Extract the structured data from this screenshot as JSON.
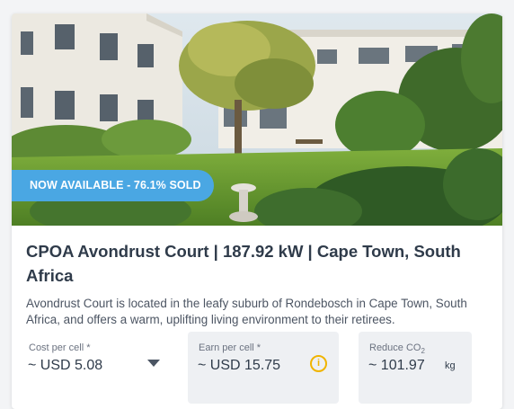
{
  "listing": {
    "badge": "NOW AVAILABLE - 76.1% SOLD",
    "title": "CPOA Avondrust Court | 187.92 kW | Cape Town, South Africa",
    "description": "Avondrust Court is located in the leafy suburb of Rondebosch in Cape Town, South Africa, and offers a warm, uplifting living environment to their retirees."
  },
  "fields": {
    "cost": {
      "label": "Cost per cell *",
      "value": "~ USD 5.08"
    },
    "earn": {
      "label": "Earn per cell *",
      "value": "~ USD 15.75"
    },
    "reduce": {
      "label_main": "Reduce CO",
      "label_sub": "2",
      "value": "~ 101.97",
      "unit": "kg"
    }
  },
  "colors": {
    "badge": "#4aa7e3",
    "info": "#f0b400",
    "title": "#2f3b4a"
  },
  "icons": {
    "dropdown": "chevron-down-icon",
    "info": "info-icon"
  }
}
